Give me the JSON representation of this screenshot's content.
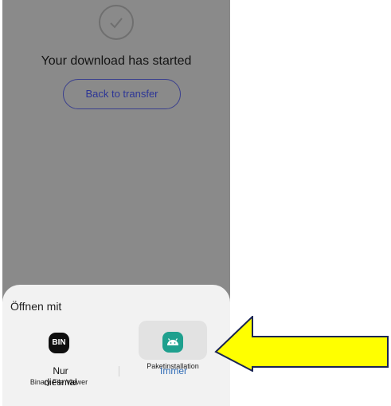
{
  "background_page": {
    "download_title": "Your download has started",
    "back_button_label": "Back to transfer"
  },
  "open_with_sheet": {
    "title": "Öffnen mit",
    "apps": [
      {
        "label": "Binary File Viewer",
        "icon_text": "BIN",
        "icon": "bin-app-icon",
        "icon_bg": "#0f0f0f",
        "selected": false
      },
      {
        "label": "Paketinstallation",
        "icon": "android-package-icon",
        "icon_bg": "#1fa08e",
        "selected": true
      }
    ],
    "once_button_label": "Nur diesmal",
    "always_button_label": "Immer"
  },
  "annotation": {
    "icon": "yellow-pointer-arrow",
    "color": "#ffff00",
    "outline": "#1b2554"
  },
  "colors": {
    "dim_overlay": "#8a8a8a",
    "sheet_bg": "#f2f2f2",
    "always_blue": "#2f6bb5",
    "back_button_blue": "#2c3596"
  }
}
